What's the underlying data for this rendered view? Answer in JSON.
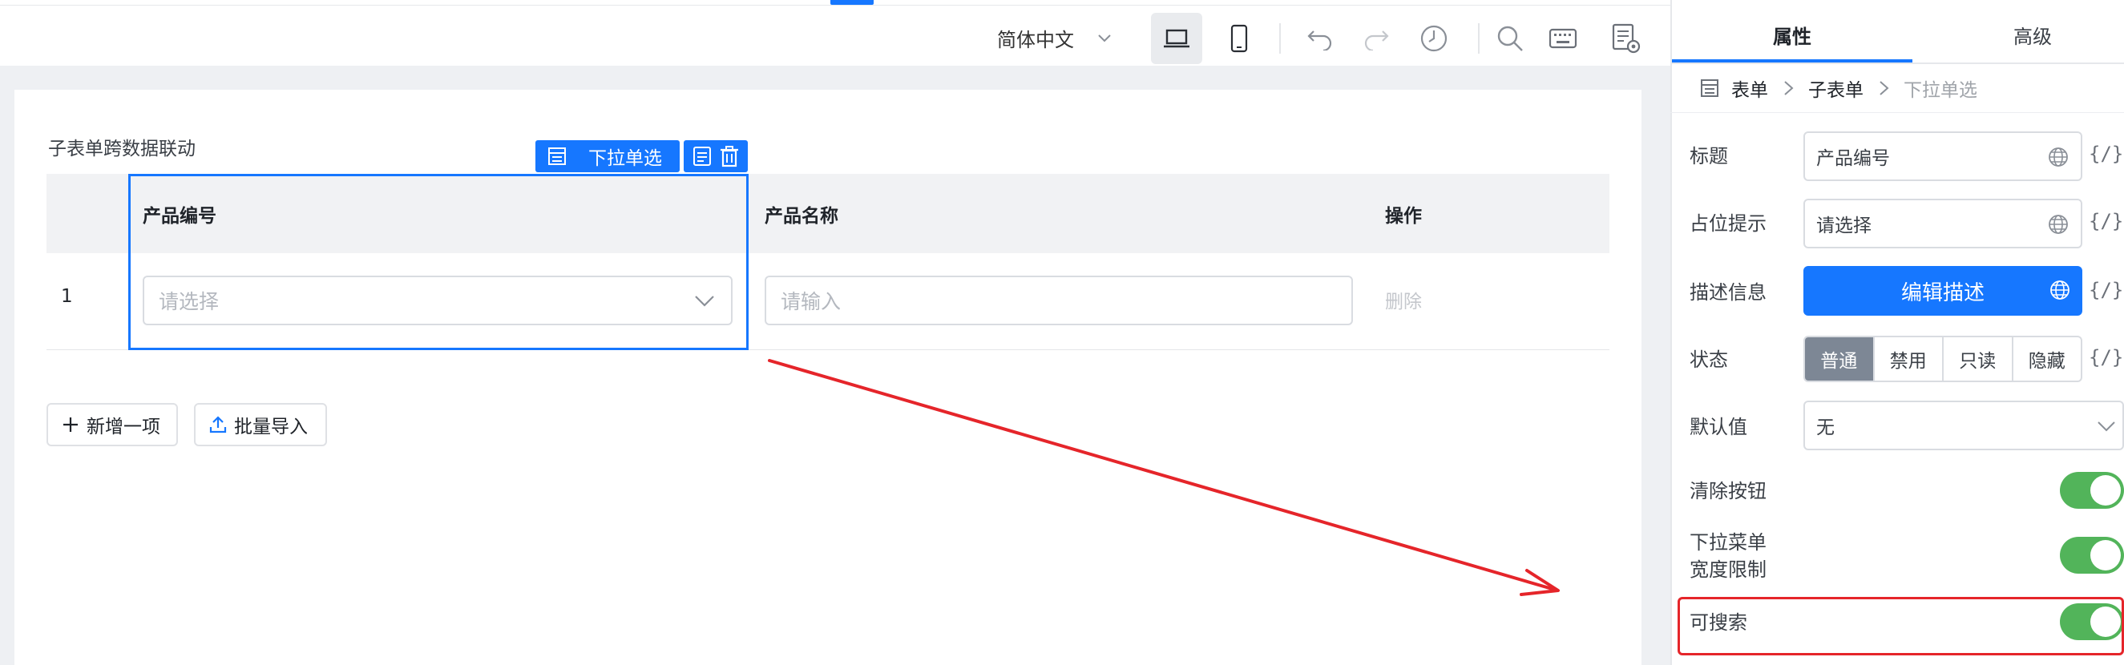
{
  "toolbar": {
    "language": "简体中文",
    "icons": [
      "chevron-down-icon",
      "desktop-icon",
      "mobile-icon",
      "undo-icon",
      "redo-icon",
      "history-icon",
      "search-icon",
      "keyboard-icon",
      "settings-doc-icon"
    ]
  },
  "canvas": {
    "subform_title": "子表单跨数据联动",
    "selected_tag": "下拉单选",
    "columns": {
      "col1": "产品编号",
      "col2": "产品名称",
      "col3": "操作"
    },
    "row": {
      "index": "1",
      "select_placeholder": "请选择",
      "input_placeholder": "请输入",
      "delete_label": "删除"
    },
    "add_item_label": "新增一项",
    "bulk_import_label": "批量导入"
  },
  "panel": {
    "tabs": {
      "properties": "属性",
      "advanced": "高级"
    },
    "breadcrumb": {
      "root": "表单",
      "middle": "子表单",
      "current": "下拉单选"
    },
    "title_label": "标题",
    "title_value": "产品编号",
    "placeholder_label": "占位提示",
    "placeholder_value": "请选择",
    "desc_label": "描述信息",
    "desc_button": "编辑描述",
    "status_label": "状态",
    "status_options": {
      "normal": "普通",
      "disabled": "禁用",
      "readonly": "只读",
      "hidden": "隐藏"
    },
    "status_selected": "普通",
    "default_label": "默认值",
    "default_value": "无",
    "clear_label": "清除按钮",
    "clear_on": true,
    "dropdown_width_label_1": "下拉菜单",
    "dropdown_width_label_2": "宽度限制",
    "dropdown_width_on": true,
    "searchable_label": "可搜索",
    "searchable_on": true,
    "code_icon": "{/}"
  },
  "colors": {
    "accent": "#1677ff",
    "toggle_on": "#52b45a",
    "annotation": "#e5252a",
    "segment_active": "#7d8795"
  }
}
